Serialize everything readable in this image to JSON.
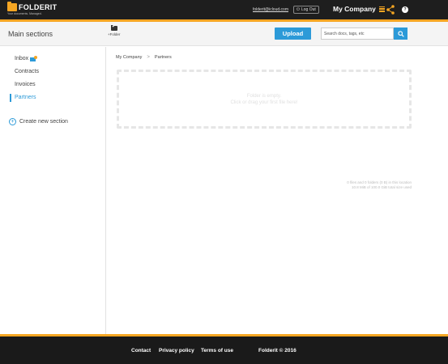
{
  "topbar": {
    "logo_text": "FOLDERIT",
    "logo_tagline": "Your documents. Managed.",
    "user_email": "folderit@icloud.com",
    "logout_label": "Log Out",
    "company_name": "My Company",
    "help_label": "?"
  },
  "header": {
    "title": "Main sections",
    "add_folder_label": "+Folder",
    "upload_label": "Upload",
    "search_placeholder": "Search docs, tags, etc"
  },
  "sidebar": {
    "items": [
      {
        "label": "Inbox"
      },
      {
        "label": "Contracts"
      },
      {
        "label": "Invoices"
      },
      {
        "label": "Partners"
      }
    ],
    "create_label": "Create new section"
  },
  "main": {
    "breadcrumb": [
      "My Company",
      "Partners"
    ],
    "dropzone_line1": "Folder is empty.",
    "dropzone_line2": "Click or drag your first file here!",
    "storage_line1": "0 files and 0 folders (0 B) in this location",
    "storage_line2": "10.8 MiB of 100.0 GiB total size used"
  },
  "footer": {
    "contact": "Contact",
    "privacy": "Privacy policy",
    "terms": "Terms of use",
    "copyright": "Folderit © 2016"
  },
  "colors": {
    "accent": "#f5a623",
    "primary": "#2c9ad8",
    "topbar_bg": "#1e1e1e"
  }
}
